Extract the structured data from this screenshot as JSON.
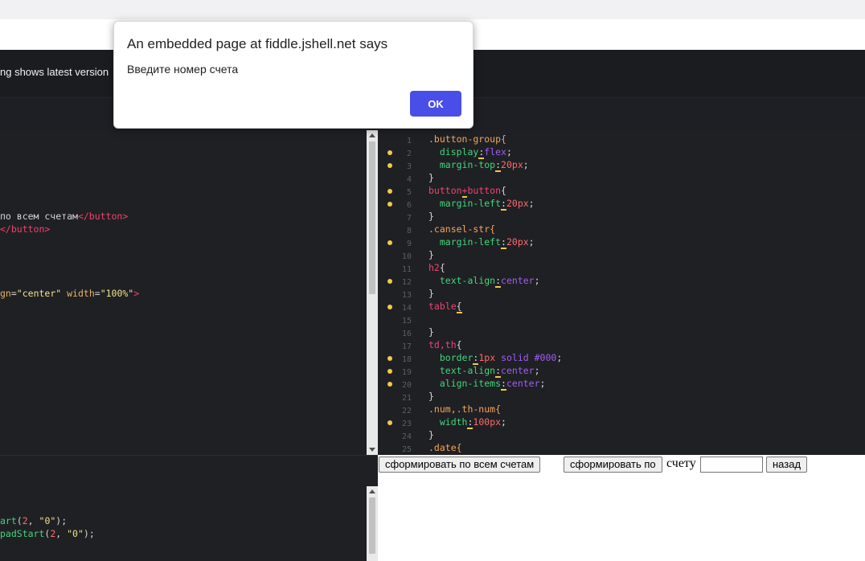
{
  "header": {
    "note": "ng shows latest version"
  },
  "dialog": {
    "title": "An embedded page at fiddle.jshell.net says",
    "message": "Введите номер счета",
    "ok_label": "OK"
  },
  "html_editor": {
    "lines": [
      {
        "text": "по всем счетам",
        "close_tag": "button"
      },
      {
        "close_tag": "button"
      },
      {
        "attr_value": "\"center\"",
        "attr2_name": "width",
        "attr2_value": "\"100%\""
      }
    ]
  },
  "css_editor": {
    "line_numbers": [
      "1",
      "2",
      "3",
      "4",
      "5",
      "6",
      "7",
      "8",
      "9",
      "10",
      "11",
      "12",
      "13",
      "14",
      "15",
      "16",
      "17",
      "18",
      "19",
      "20",
      "21",
      "22",
      "23",
      "24",
      "25"
    ],
    "code": {
      "l1_sel": ".button-group{",
      "l2_prop": "display",
      "l2_val": "flex",
      "l3_prop": "margin-top",
      "l3_num": "20px",
      "l5_a": "button",
      "l5_b": "+",
      "l5_c": "button",
      "l6_prop": "margin-left",
      "l6_num": "20px",
      "l8_sel": ".cansel-str{",
      "l9_prop": "margin-left",
      "l9_num": "20px",
      "l11_sel": "h2",
      "l12_prop": "text-align",
      "l12_val": "center",
      "l14_sel": "table",
      "l17_sel": "td,th",
      "l18_prop": "border",
      "l18_num": "1px",
      "l18_val": "solid #000",
      "l19_prop": "text-align",
      "l19_val": "center",
      "l20_prop": "align-items",
      "l20_val": "center",
      "l22_sel": ".num,.th-num{",
      "l23_prop": "width",
      "l23_num": "100px",
      "l25_sel": ".date{"
    }
  },
  "js_editor": {
    "line1": {
      "fn": "art",
      "num": "2",
      "str": "\"0\""
    },
    "line2": {
      "fn": "padStart",
      "num": "2",
      "str": "\"0\""
    }
  },
  "result": {
    "btn_all": "сформировать по всем счетам",
    "btn_by": "сформировать по",
    "label_account": "счету",
    "btn_back": "назад"
  }
}
